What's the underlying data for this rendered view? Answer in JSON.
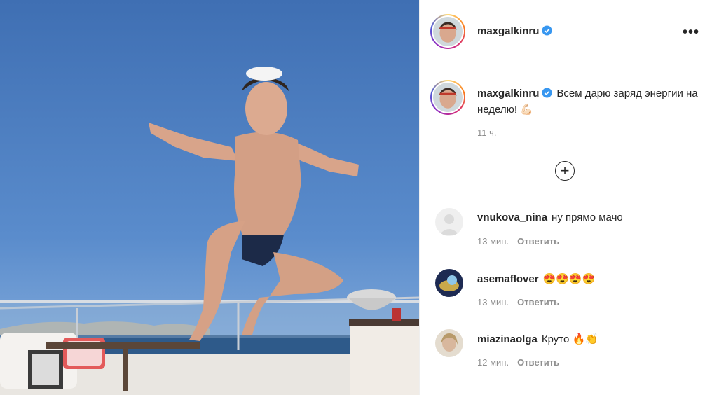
{
  "post": {
    "author": "maxgalkinru",
    "more_icon": "more-horizontal-icon",
    "caption_text": "Всем дарю заряд энергии на неделю! 💪🏻",
    "time": "11 ч.",
    "load_more_icon": "plus-circle-icon"
  },
  "comments": [
    {
      "username": "vnukova_nina",
      "text": "ну прямо мачо",
      "time": "13 мин.",
      "reply": "Ответить"
    },
    {
      "username": "asemaflover",
      "text": "😍😍😍😍",
      "time": "13 мин.",
      "reply": "Ответить"
    },
    {
      "username": "miazinaolga",
      "text": "Круто 🔥👏",
      "time": "12 мин.",
      "reply": "Ответить"
    }
  ],
  "colors": {
    "verified": "#3897f0",
    "sky": "#4f7fc4",
    "sea": "#2e5a8a"
  }
}
